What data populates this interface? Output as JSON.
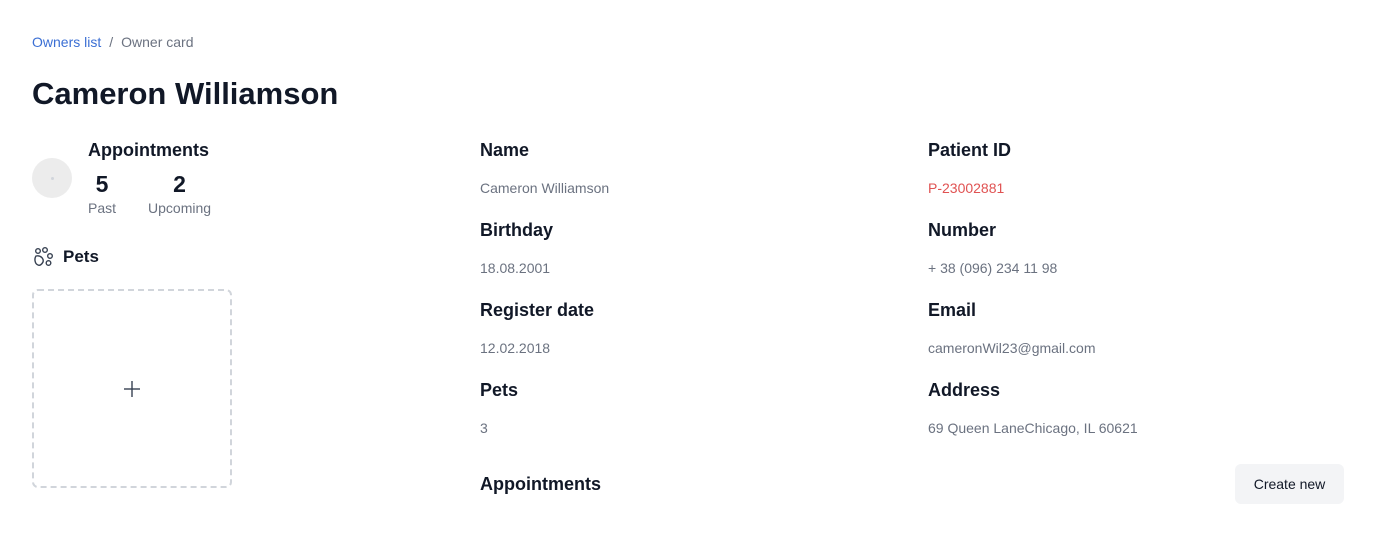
{
  "breadcrumb": {
    "link": "Owners list",
    "separator": "/",
    "current": "Owner card"
  },
  "page_title": "Cameron Williamson",
  "appointments_summary": {
    "title": "Appointments",
    "past_value": "5",
    "past_label": "Past",
    "upcoming_value": "2",
    "upcoming_label": "Upcoming"
  },
  "pets_section": {
    "title": "Pets",
    "icon": "paw-icon",
    "add_icon": "plus-icon"
  },
  "details_left": [
    {
      "label": "Name",
      "value": "Cameron Williamson"
    },
    {
      "label": "Birthday",
      "value": "18.08.2001"
    },
    {
      "label": "Register date",
      "value": "12.02.2018"
    },
    {
      "label": "Pets",
      "value": "3"
    }
  ],
  "details_right": [
    {
      "label": "Patient ID",
      "value": "P-23002881"
    },
    {
      "label": "Number",
      "value": "+ 38 (096) 234 11 98"
    },
    {
      "label": "Email",
      "value": "cameronWil23@gmail.com"
    },
    {
      "label": "Address",
      "value": "69 Queen LaneChicago, IL 60621"
    }
  ],
  "appointments_section": {
    "title": "Appointments",
    "create_label": "Create new"
  },
  "colors": {
    "link": "#3b6fd4",
    "patient_id": "#e05252",
    "button_bg": "#f3f4f6"
  }
}
